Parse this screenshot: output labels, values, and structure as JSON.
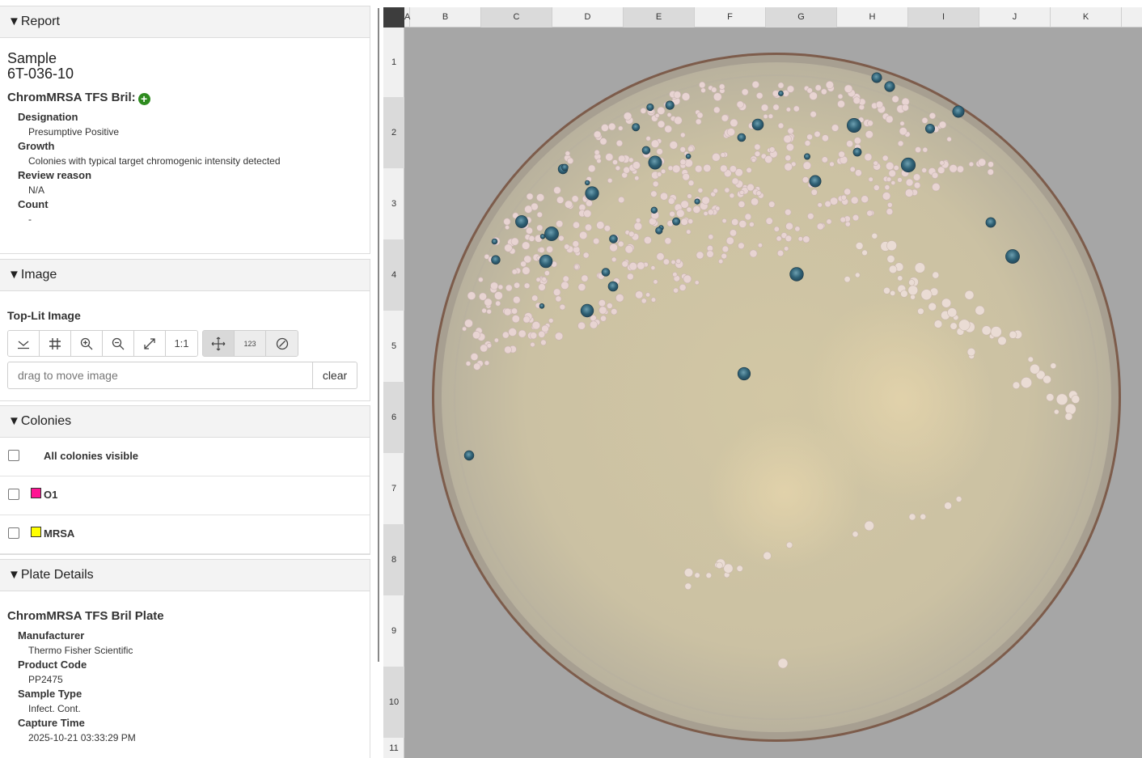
{
  "report": {
    "header": "Report",
    "sample_label": "Sample",
    "sample_id": "6T-036-10",
    "plate_title": "ChromMRSA TFS Bril:",
    "fields": [
      {
        "label": "Designation",
        "value": "Presumptive Positive"
      },
      {
        "label": "Growth",
        "value": "Colonies with typical target chromogenic intensity detected"
      },
      {
        "label": "Review reason",
        "value": "N/A"
      },
      {
        "label": "Count",
        "value": "-"
      }
    ]
  },
  "image": {
    "header": "Image",
    "subtitle": "Top-Lit Image",
    "toolbar": {
      "buttons": [
        "download-icon",
        "grid-icon",
        "zoom-in-icon",
        "zoom-out-icon",
        "expand-icon",
        "1:1"
      ],
      "mode_buttons": [
        "move-icon",
        "123",
        "ban-icon"
      ]
    },
    "input_placeholder": "drag to move image",
    "clear_label": "clear"
  },
  "colonies": {
    "header": "Colonies",
    "all_label": "All colonies visible",
    "items": [
      {
        "label": "O1",
        "color": "#ff1493"
      },
      {
        "label": "MRSA",
        "color": "#ffff00"
      }
    ]
  },
  "plate_details": {
    "header": "Plate Details",
    "title": "ChromMRSA TFS Bril Plate",
    "fields": [
      {
        "label": "Manufacturer",
        "value": "Thermo Fisher Scientific"
      },
      {
        "label": "Product Code",
        "value": "PP2475"
      },
      {
        "label": "Sample Type",
        "value": "Infect. Cont."
      },
      {
        "label": "Capture Time",
        "value": "2025-10-21 03:33:29 PM"
      }
    ]
  },
  "viewer": {
    "columns": [
      "A",
      "B",
      "C",
      "D",
      "E",
      "F",
      "G",
      "H",
      "I",
      "J",
      "K"
    ],
    "rows": [
      "1",
      "2",
      "3",
      "4",
      "5",
      "6",
      "7",
      "8",
      "9",
      "10",
      "11"
    ],
    "colors": {
      "background": "#a6a6a6",
      "agar": "#cfc5a6",
      "rim": "#8a6a55",
      "pink_colony": "#e8d4d2",
      "blue_colony": "#2f6175"
    }
  }
}
